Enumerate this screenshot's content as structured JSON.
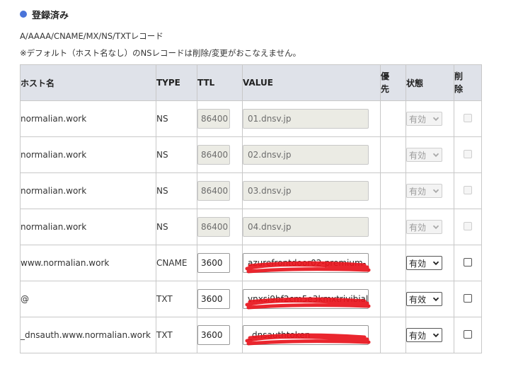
{
  "section": {
    "title": "登録済み",
    "accent_color": "#4a74d9"
  },
  "notes": {
    "types": "A/AAAA/CNAME/MX/NS/TXTレコード",
    "warning": "※デフォルト（ホスト名なし）のNSレコードは削除/変更がおこなえません。"
  },
  "table": {
    "headers": {
      "host": "ホスト名",
      "type": "TYPE",
      "ttl": "TTL",
      "value": "VALUE",
      "priority_1": "優",
      "priority_2": "先",
      "status": "状態",
      "delete_1": "削",
      "delete_2": "除"
    },
    "rows": [
      {
        "host": "normalian.work",
        "type": "NS",
        "ttl": "86400",
        "value": "01.dnsv.jp",
        "status": "有効",
        "editable": false
      },
      {
        "host": "normalian.work",
        "type": "NS",
        "ttl": "86400",
        "value": "02.dnsv.jp",
        "status": "有効",
        "editable": false
      },
      {
        "host": "normalian.work",
        "type": "NS",
        "ttl": "86400",
        "value": "03.dnsv.jp",
        "status": "有効",
        "editable": false
      },
      {
        "host": "normalian.work",
        "type": "NS",
        "ttl": "86400",
        "value": "04.dnsv.jp",
        "status": "有効",
        "editable": false
      },
      {
        "host": "www.normalian.work",
        "type": "CNAME",
        "ttl": "3600",
        "value": "azurefrontdoor02-premium-",
        "status": "有効",
        "editable": true,
        "redacted": true
      },
      {
        "host": "@",
        "type": "TXT",
        "ttl": "3600",
        "value": "vnxsi9bf2cm5e3kmxtrivibial",
        "status": "有效",
        "editable": true,
        "redacted": true
      },
      {
        "host": "_dnsauth.www.normalian.work",
        "type": "TXT",
        "ttl": "3600",
        "value": "_dnsauthtoken",
        "status": "有効",
        "editable": true,
        "redacted": true
      }
    ]
  },
  "colors": {
    "header_bg": "#dfe2e9",
    "redaction": "#e8141c"
  }
}
